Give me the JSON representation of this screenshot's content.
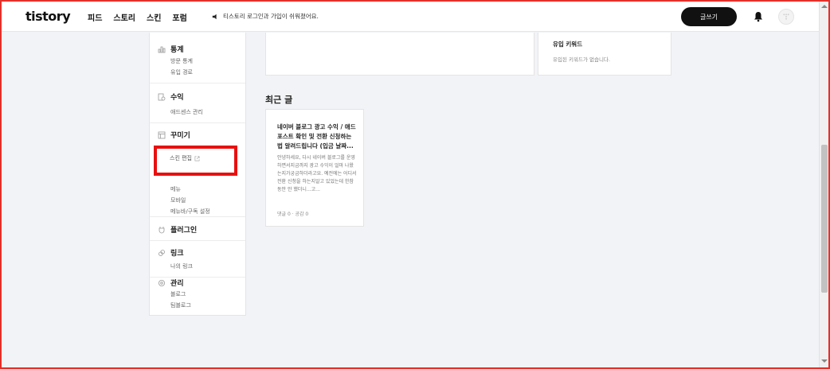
{
  "header": {
    "logo": "tistory",
    "nav": [
      "피드",
      "스토리",
      "스킨",
      "포럼"
    ],
    "notice": "티스토리 로그인과 가입이 쉬워졌어요.",
    "write_button": "글쓰기"
  },
  "sidebar": {
    "stats": {
      "title": "통계",
      "items": [
        "방문 통계",
        "유입 경로"
      ]
    },
    "revenue": {
      "title": "수익",
      "items": [
        "애드센스 관리"
      ]
    },
    "decorate": {
      "title": "꾸미기",
      "skin_edit": "스킨 편집",
      "items": [
        "메뉴",
        "모바일",
        "메뉴바/구독 설정"
      ]
    },
    "plugin": {
      "title": "플러그인"
    },
    "link": {
      "title": "링크",
      "items": [
        "나의 링크"
      ]
    },
    "manage": {
      "title": "관리",
      "items": [
        "블로그",
        "팀블로그"
      ]
    }
  },
  "keywords": {
    "title": "유입 키워드",
    "empty": "유입된 키워드가 없습니다."
  },
  "recent": {
    "title": "최근 글",
    "post": {
      "title": "네이버 블로그 광고 수익 / 애드포스트 확인 및 전환 신청하는 법 알려드립니다 (입금 날짜...",
      "body": "안녕하세요, 다시 네이버 블로그를 운영하면서지금까지 광고 수익이 얼마 나왔는지가궁금하더라고요. 예전에는 어디서 전환 신청을 하는지알고 있었는데 한참 동안 안 했더니...고...",
      "meta": "댓글 0 · 공감 0"
    }
  },
  "colors": {
    "highlight": "#e8100f",
    "accent": "#111111"
  }
}
